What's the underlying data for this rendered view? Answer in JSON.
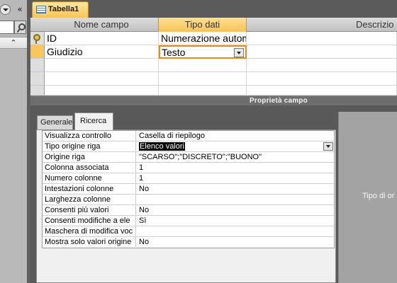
{
  "document_tab": {
    "label": "Tabella1",
    "icon": "table-icon"
  },
  "grid": {
    "headers": {
      "field_name": "Nome campo",
      "data_type": "Tipo dati",
      "description": "Descrizio"
    },
    "rows": [
      {
        "field_name": "ID",
        "data_type": "Numerazione automatica",
        "description": "",
        "primary_key": true
      },
      {
        "field_name": "Giudizio",
        "data_type": "Testo",
        "description": "",
        "selected": true
      }
    ]
  },
  "properties": {
    "title": "Proprietà campo",
    "tabs": [
      "Generale",
      "Ricerca"
    ],
    "active_tab": "Ricerca",
    "rows": [
      {
        "label": "Visualizza controllo",
        "value": "Casella di riepilogo"
      },
      {
        "label": "Tipo origine riga",
        "value": "Elenco valori"
      },
      {
        "label": "Origine riga",
        "value": "\"SCARSO\";\"DISCRETO\";\"BUONO\""
      },
      {
        "label": "Colonna associata",
        "value": "1"
      },
      {
        "label": "Numero colonne",
        "value": "1"
      },
      {
        "label": "Intestazioni colonne",
        "value": "No"
      },
      {
        "label": "Larghezza colonne",
        "value": ""
      },
      {
        "label": "Consenti più valori",
        "value": "No"
      },
      {
        "label": "Consenti modifiche a ele",
        "value": "Sì"
      },
      {
        "label": "Maschera di modifica voc",
        "value": ""
      },
      {
        "label": "Mostra solo valori origine",
        "value": "No"
      }
    ]
  },
  "help": {
    "text": "Tipo di or"
  },
  "colors": {
    "accent": "#f7c35a",
    "selection": "#000000",
    "active_cell_border": "#e88a17"
  }
}
